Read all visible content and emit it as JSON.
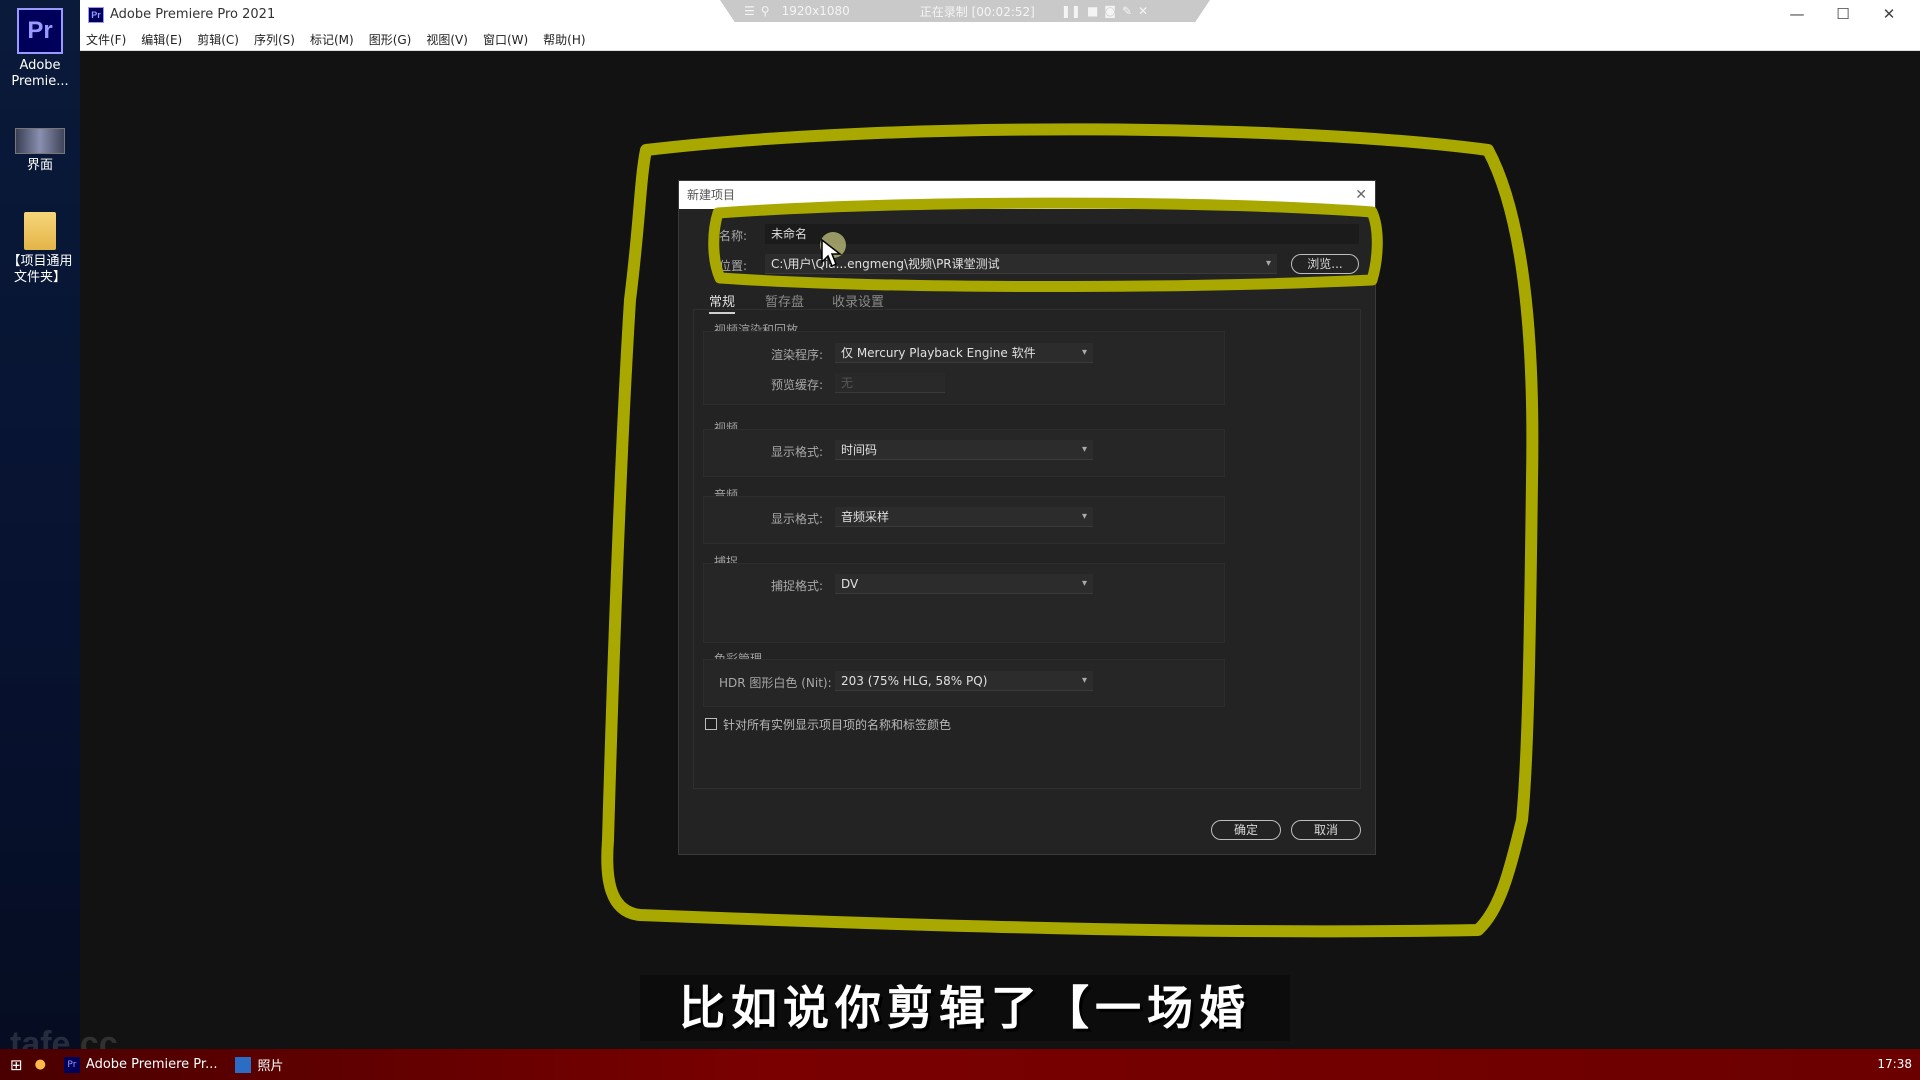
{
  "desktop": {
    "icons": [
      {
        "tile": "Pr",
        "label": "Adobe Premie..."
      },
      {
        "label": "界面"
      },
      {
        "label": "【项目通用文件夹】"
      }
    ]
  },
  "window": {
    "icon": "Pr",
    "title": "Adobe Premiere Pro 2021",
    "recorder": {
      "resolution": "1920x1080",
      "status": "正在录制 [00:02:52]"
    },
    "menu": [
      "文件(F)",
      "编辑(E)",
      "剪辑(C)",
      "序列(S)",
      "标记(M)",
      "图形(G)",
      "视图(V)",
      "窗口(W)",
      "帮助(H)"
    ]
  },
  "dialog": {
    "title": "新建项目",
    "name_label": "名称:",
    "name_value": "未命名",
    "location_label": "位置:",
    "location_value": "C:\\用户\\Qia...engmeng\\视频\\PR课堂测试",
    "browse_button": "浏览...",
    "tabs": [
      "常规",
      "暂存盘",
      "收录设置"
    ],
    "sections": {
      "playback": {
        "title": "视频渲染和回放",
        "renderer_label": "渲染程序:",
        "renderer_value": "仅 Mercury Playback Engine 软件",
        "preview_cache_label": "预览缓存:",
        "preview_cache_value": "无"
      },
      "video": {
        "title": "视频",
        "display_label": "显示格式:",
        "display_value": "时间码"
      },
      "audio": {
        "title": "音频",
        "display_label": "显示格式:",
        "display_value": "音频采样"
      },
      "capture": {
        "title": "捕捉",
        "format_label": "捕捉格式:",
        "format_value": "DV"
      },
      "color": {
        "title": "色彩管理",
        "hdr_label": "HDR 图形白色 (Nit):",
        "hdr_value": "203 (75% HLG, 58% PQ)"
      }
    },
    "checkbox_label": "针对所有实例显示项目项的名称和标签颜色",
    "ok_button": "确定",
    "cancel_button": "取消"
  },
  "subtitle": "比如说你剪辑了【一场婚礼】",
  "watermark": "tafe.cc",
  "taskbar": {
    "items": [
      "Adobe Premiere Pr...",
      "照片"
    ],
    "clock": "17:38"
  },
  "colors": {
    "annotation": "#a8a800",
    "accent_pr": "#9999ff",
    "taskbar": "#7a0000"
  }
}
